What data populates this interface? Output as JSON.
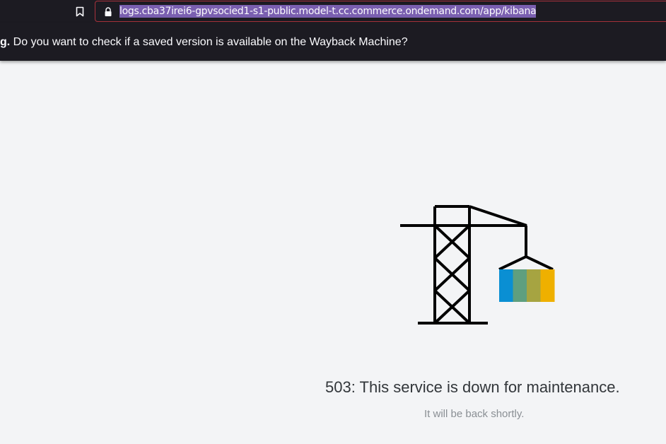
{
  "browser": {
    "url": "logs.cba37irei6-gpvsocied1-s1-public.model-t.cc.commerce.ondemand.com/app/kibana"
  },
  "notice": {
    "lead": "g.",
    "message": "Do you want to check if a saved version is available on the Wayback Machine?"
  },
  "error": {
    "title": "503: This service is down for maintenance.",
    "subtitle": "It will be back shortly."
  },
  "illustration": {
    "name": "crane-icon",
    "container_colors": [
      "#0a8fd3",
      "#5f9f7f",
      "#a6a441",
      "#efb000"
    ],
    "line_color": "#000000"
  }
}
